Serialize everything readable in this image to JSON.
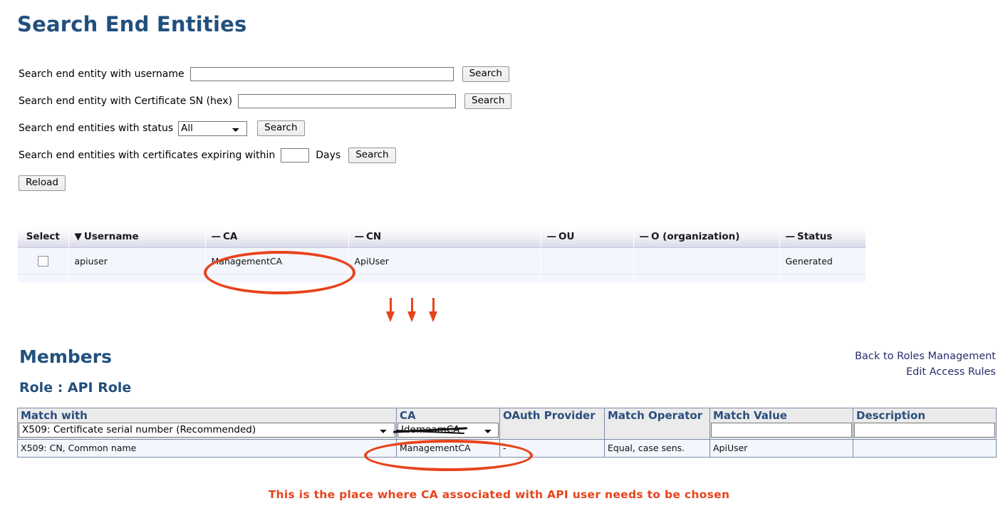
{
  "page": {
    "title": "Search End Entities"
  },
  "search_form": {
    "rows": [
      {
        "label": "Search end entity with username",
        "input_value": "",
        "input_placeholder": "",
        "button": "Search"
      },
      {
        "label": "Search end entity with Certificate SN (hex)",
        "input_value": "",
        "input_placeholder": "",
        "button": "Search"
      },
      {
        "label": "Search end entities with status",
        "select_value": "All",
        "select_options": [
          "All"
        ],
        "button": "Search"
      },
      {
        "label": "Search end entities with certificates expiring within",
        "input_value": "",
        "input_placeholder": "",
        "suffix": "Days",
        "button": "Search"
      }
    ],
    "reload_button": "Reload"
  },
  "entities_table": {
    "headers": [
      {
        "label": "Select",
        "sort": ""
      },
      {
        "label": "Username",
        "sort": "▼"
      },
      {
        "label": "CA",
        "sort": "—"
      },
      {
        "label": "CN",
        "sort": "—"
      },
      {
        "label": "OU",
        "sort": "—"
      },
      {
        "label": "O (organization)",
        "sort": "—"
      },
      {
        "label": "Status",
        "sort": "—"
      }
    ],
    "rows": [
      {
        "select": "",
        "username": "apiuser",
        "ca": "ManagementCA",
        "cn": "ApiUser",
        "ou": "",
        "o": "",
        "status": "Generated"
      }
    ]
  },
  "members": {
    "title": "Members",
    "role_title": "Role : API Role",
    "links": [
      "Back to Roles Management",
      "Edit Access Rules"
    ],
    "headers": [
      "Match with",
      "CA",
      "OAuth Provider",
      "Match Operator",
      "Match Value",
      "Description"
    ],
    "filter_row": {
      "match_with_value": "X509: Certificate serial number (Recommended)",
      "match_with_options": [
        "X509: Certificate serial number (Recommended)"
      ],
      "ca_value": "IdemeamCA",
      "ca_options": [
        "IdemeamCA"
      ],
      "oauth_provider": "",
      "match_operator": "",
      "match_value": "",
      "match_value_placeholder": "",
      "description": "",
      "description_placeholder": ""
    },
    "rows": [
      {
        "match_with": "X509: CN, Common name",
        "ca": "ManagementCA",
        "oauth_provider": "-",
        "match_operator": "Equal, case sens.",
        "match_value": "ApiUser",
        "description": ""
      }
    ]
  },
  "annotations": {
    "caption": "This is the place where CA associated with API user needs to be chosen",
    "color": "#e8431c"
  }
}
